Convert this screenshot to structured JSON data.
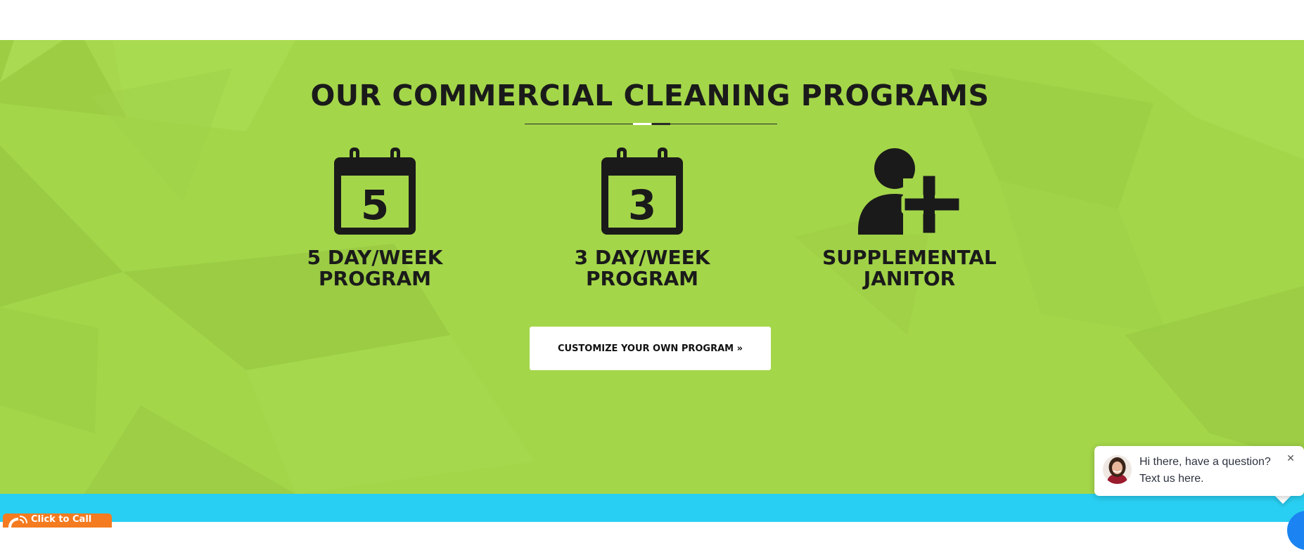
{
  "section": {
    "title": "OUR COMMERCIAL CLEANING PROGRAMS"
  },
  "programs": [
    {
      "icon": "calendar-5-icon",
      "day_number": "5",
      "label": "5 DAY/WEEK\nPROGRAM"
    },
    {
      "icon": "calendar-3-icon",
      "day_number": "3",
      "label": "3 DAY/WEEK\nPROGRAM"
    },
    {
      "icon": "user-plus-icon",
      "label": "SUPPLEMENTAL\nJANITOR"
    }
  ],
  "cta": {
    "label": "CUSTOMIZE YOUR OWN PROGRAM »"
  },
  "chat": {
    "message": "Hi there, have a question? Text us here.",
    "close_symbol": "✕",
    "avatar": "avatar"
  },
  "call_badge": {
    "label": "Click to Call",
    "icon": "phone-icon"
  },
  "colors": {
    "section_green": "#a4d64a",
    "section_blue": "#29cff2",
    "text_dark": "#1a1a1a",
    "call_orange": "#f47b20",
    "chat_blue": "#1b84f2"
  }
}
